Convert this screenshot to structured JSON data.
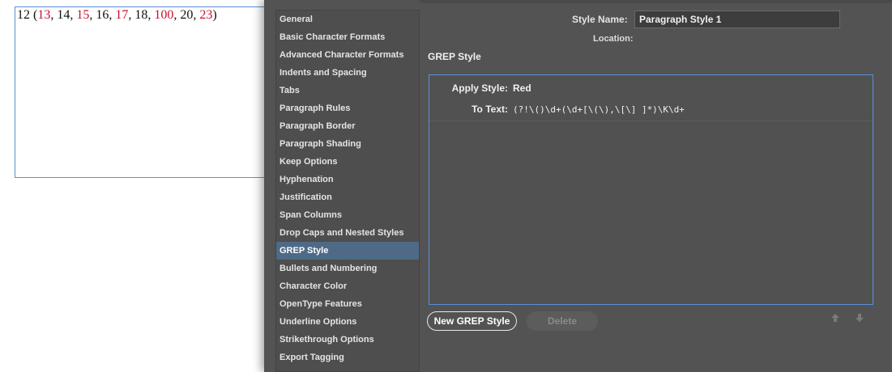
{
  "document": {
    "frame_text_parts": [
      {
        "text": "12 (",
        "red": false
      },
      {
        "text": "13",
        "red": true
      },
      {
        "text": ", 14, ",
        "red": false
      },
      {
        "text": "15",
        "red": true
      },
      {
        "text": ", 16, ",
        "red": false
      },
      {
        "text": "17",
        "red": true
      },
      {
        "text": ", 18, ",
        "red": false
      },
      {
        "text": "100",
        "red": true
      },
      {
        "text": ", 20, ",
        "red": false
      },
      {
        "text": "23",
        "red": true
      },
      {
        "text": ")",
        "red": false
      }
    ]
  },
  "dialog": {
    "style_name_label": "Style Name:",
    "style_name_value": "Paragraph Style 1",
    "location_label": "Location:",
    "section_title": "GREP Style",
    "sidebar": {
      "selected": "GREP Style",
      "items": [
        "General",
        "Basic Character Formats",
        "Advanced Character Formats",
        "Indents and Spacing",
        "Tabs",
        "Paragraph Rules",
        "Paragraph Border",
        "Paragraph Shading",
        "Keep Options",
        "Hyphenation",
        "Justification",
        "Span Columns",
        "Drop Caps and Nested Styles",
        "GREP Style",
        "Bullets and Numbering",
        "Character Color",
        "OpenType Features",
        "Underline Options",
        "Strikethrough Options",
        "Export Tagging"
      ]
    },
    "grep": {
      "apply_style_label": "Apply Style:",
      "apply_style_value": "Red",
      "to_text_label": "To Text:",
      "to_text_value": "(?!\\()\\d+(\\d+[\\(\\),\\[\\] ]*)\\K\\d+"
    },
    "buttons": {
      "new_grep_style": "New GREP Style",
      "delete": "Delete"
    },
    "icons": {
      "move_up": "arrow-up-icon",
      "move_down": "arrow-down-icon"
    },
    "colors": {
      "dialog_bg": "#535353",
      "selection": "#4f6a87",
      "focus_border": "#5b8fd6",
      "red_text": "#c8102e"
    }
  }
}
